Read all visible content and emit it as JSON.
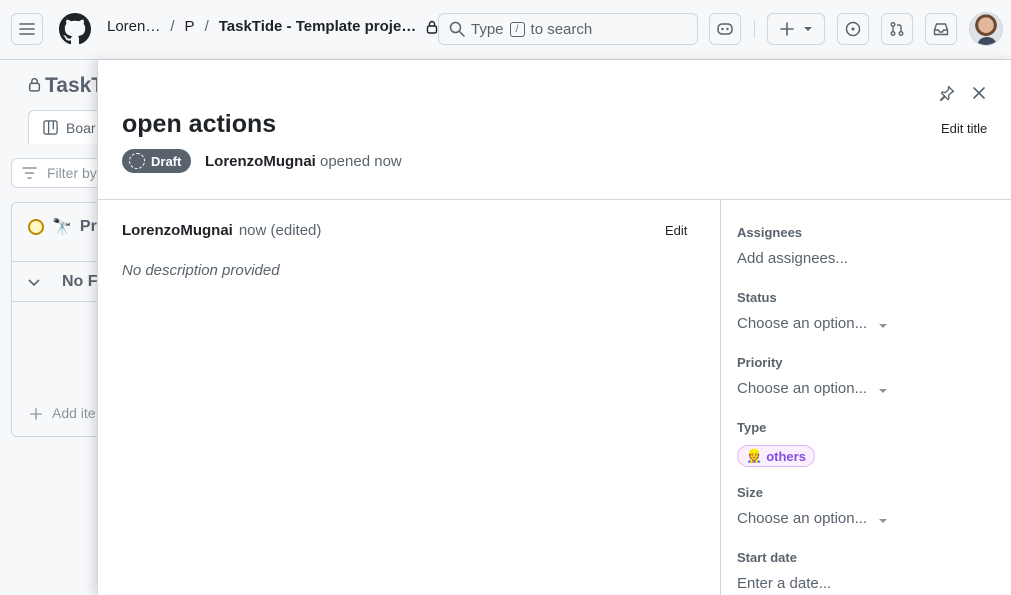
{
  "header": {
    "owner": "Loren…",
    "sep1": "/",
    "folder": "P",
    "sep2": "/",
    "project": "TaskTide - Template proje…",
    "search_type": "Type",
    "search_key": "/",
    "search_suffix": "to search"
  },
  "background": {
    "title": "TaskT",
    "tab_board": "Boar",
    "filter_placeholder": "Filter by",
    "group_emoji": "🔭",
    "group_label": "Pro",
    "no_field": "No F",
    "add_item": "Add ite"
  },
  "panel": {
    "title": "open actions",
    "edit_title": "Edit title",
    "draft_label": "Draft",
    "author": "LorenzoMugnai",
    "opened_text": "opened now",
    "comment": {
      "author": "LorenzoMugnai",
      "time": "now (edited)",
      "edit_label": "Edit",
      "description": "No description provided"
    }
  },
  "sidebar": {
    "assignees": {
      "label": "Assignees",
      "value": "Add assignees..."
    },
    "status": {
      "label": "Status",
      "value": "Choose an option..."
    },
    "priority": {
      "label": "Priority",
      "value": "Choose an option..."
    },
    "type": {
      "label": "Type",
      "emoji": "👷",
      "value": "others"
    },
    "size": {
      "label": "Size",
      "value": "Choose an option..."
    },
    "start_date": {
      "label": "Start date",
      "value": "Enter a date..."
    }
  },
  "colors": {
    "draft_bg": "#59636e",
    "type_chip_text": "#8250df",
    "type_chip_bg": "#fbefff"
  }
}
